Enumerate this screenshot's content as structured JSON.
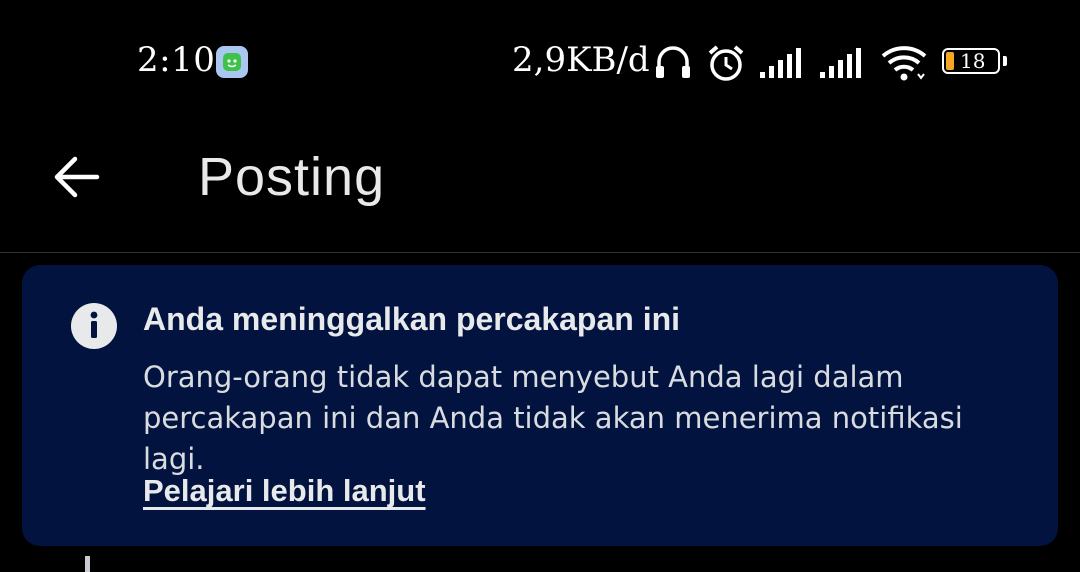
{
  "status_bar": {
    "time": "2:10",
    "net_speed": "2,9KB/d",
    "battery_level": "18",
    "icons": [
      "app-notification-icon",
      "headphones-icon",
      "alarm-icon",
      "signal-icon",
      "signal-icon",
      "wifi-icon",
      "battery-icon"
    ],
    "battery_color": "#f5a623"
  },
  "header": {
    "back_icon": "arrow-left-icon",
    "title": "Posting"
  },
  "notice": {
    "icon": "info-icon",
    "title": "Anda meninggalkan percakapan ini",
    "body_line1": "Orang-orang tidak dapat menyebut Anda lagi dalam",
    "body_line2": "percakapan ini dan Anda tidak akan menerima notifikasi lagi.",
    "link_label": "Pelajari lebih lanjut",
    "background": "#031340"
  }
}
